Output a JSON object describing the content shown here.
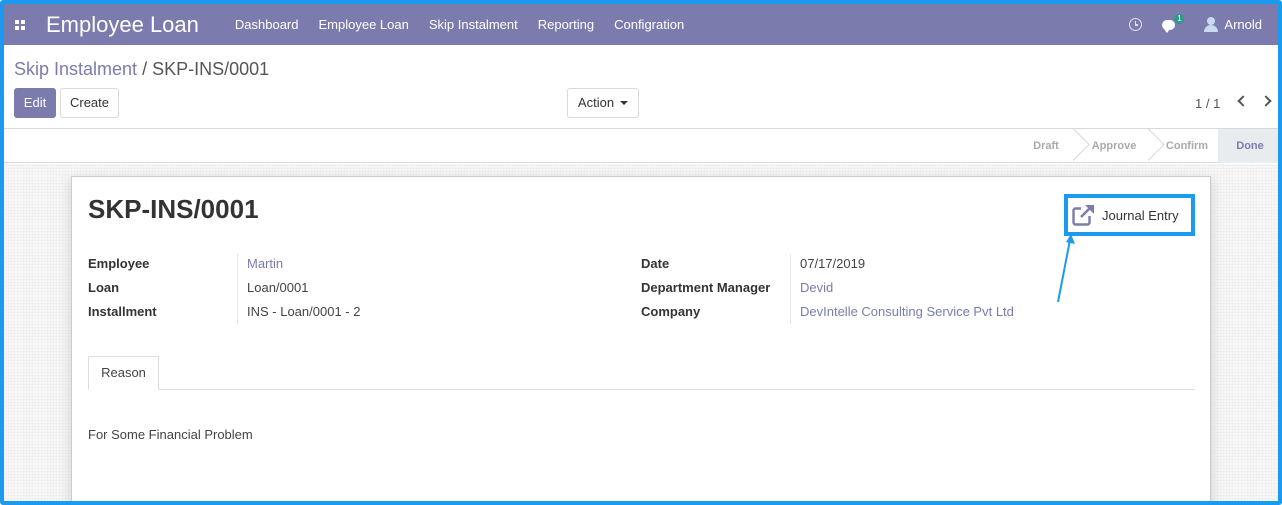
{
  "navbar": {
    "brand": "Employee Loan",
    "menu": [
      "Dashboard",
      "Employee Loan",
      "Skip Instalment",
      "Reporting",
      "Configration"
    ],
    "chat_count": "1",
    "user_name": "Arnold",
    "bg_color": "#7c7bad"
  },
  "breadcrumb": {
    "parent": "Skip Instalment",
    "separator": "/",
    "current": "SKP-INS/0001"
  },
  "controls": {
    "edit_label": "Edit",
    "create_label": "Create",
    "action_label": "Action",
    "pager": "1 / 1"
  },
  "statusbar": {
    "stages": [
      "Draft",
      "Approve",
      "Confirm",
      "Done"
    ],
    "active": "Done"
  },
  "record": {
    "title": "SKP-INS/0001",
    "smart_button_label": "Journal Entry",
    "left_fields": [
      {
        "label": "Employee",
        "value": "Martin"
      },
      {
        "label": "Loan",
        "value": "Loan/0001"
      },
      {
        "label": "Installment",
        "value": "INS - Loan/0001 - 2"
      }
    ],
    "right_fields": [
      {
        "label": "Date",
        "value": "07/17/2019"
      },
      {
        "label": "Department Manager",
        "value": "Devid"
      },
      {
        "label": "Company",
        "value": "DevIntelle Consulting Service Pvt Ltd"
      }
    ],
    "tab_label": "Reason",
    "reason_text": "For Some Financial Problem"
  },
  "highlight_color": "#1a9bf0"
}
